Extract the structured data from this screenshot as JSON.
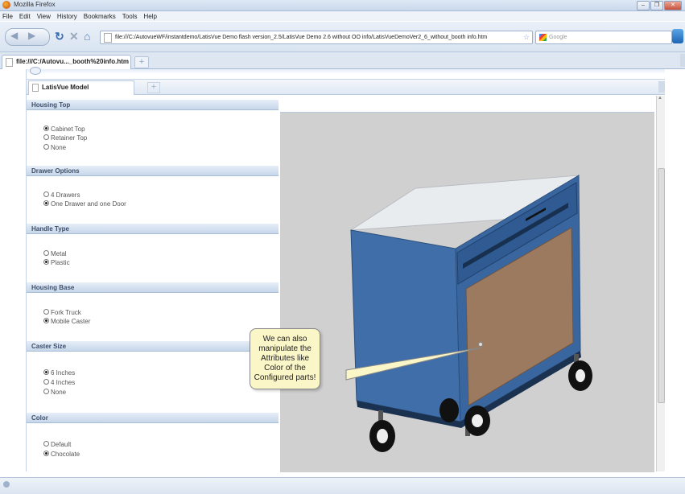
{
  "window": {
    "title": "Mozilla Firefox",
    "controls": [
      "–",
      "❐",
      "✕"
    ]
  },
  "menubar": [
    "File",
    "Edit",
    "View",
    "History",
    "Bookmarks",
    "Tools",
    "Help"
  ],
  "navbar": {
    "url": "file:///C:/AutovueWF/instantdemo/LatisVue Demo flash version_2.5/LatisVue Demo 2.6 without OO info/LatisVueDemoVer2_6_without_booth info.htm",
    "search_placeholder": "Google"
  },
  "browser_tab": {
    "label": "file:///C:/Autovu..._booth%20info.htm",
    "new_tab": "+"
  },
  "app": {
    "tab_label": "LatisVue Model",
    "tab_add": "+",
    "sections": [
      {
        "title": "Housing Top",
        "options": [
          {
            "label": "Cabinet Top",
            "selected": true
          },
          {
            "label": "Retainer Top",
            "selected": false
          },
          {
            "label": "None",
            "selected": false
          }
        ]
      },
      {
        "title": "Drawer Options",
        "options": [
          {
            "label": "4 Drawers",
            "selected": false
          },
          {
            "label": "One Drawer and one Door",
            "selected": true
          }
        ]
      },
      {
        "title": "Handle Type",
        "options": [
          {
            "label": "Metal",
            "selected": false
          },
          {
            "label": "Plastic",
            "selected": true
          }
        ]
      },
      {
        "title": "Housing Base",
        "options": [
          {
            "label": "Fork Truck",
            "selected": false
          },
          {
            "label": "Mobile Caster",
            "selected": true
          }
        ]
      },
      {
        "title": "Caster Size",
        "options": [
          {
            "label": "6 Inches",
            "selected": true
          },
          {
            "label": "4 Inches",
            "selected": false
          },
          {
            "label": "None",
            "selected": false
          }
        ]
      },
      {
        "title": "Color",
        "options": [
          {
            "label": "Default",
            "selected": false
          },
          {
            "label": "Chocolate",
            "selected": true
          }
        ]
      }
    ],
    "callout_text": "We can also manipulate the Attributes like Color of the Configured parts!",
    "colors": {
      "cabinet_body": "#3f6ea8",
      "cabinet_top": "#e9ecef",
      "door": "#9c7a5f",
      "viewer_bg": "#d0d0d0"
    }
  }
}
